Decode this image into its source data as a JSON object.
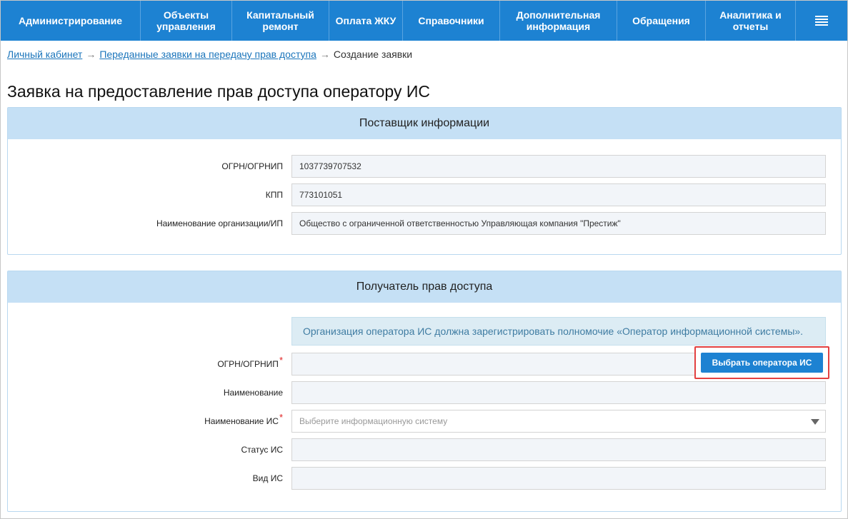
{
  "nav": {
    "items": [
      {
        "line1": "Администрирование",
        "line2": ""
      },
      {
        "line1": "Объекты",
        "line2": "управления"
      },
      {
        "line1": "Капитальный",
        "line2": "ремонт"
      },
      {
        "line1": "Оплата ЖКУ",
        "line2": ""
      },
      {
        "line1": "Справочники",
        "line2": ""
      },
      {
        "line1": "Дополнительная",
        "line2": "информация"
      },
      {
        "line1": "Обращения",
        "line2": ""
      },
      {
        "line1": "Аналитика и",
        "line2": "отчеты"
      }
    ],
    "menu_icon": "hamburger-menu-icon"
  },
  "breadcrumb": {
    "home": "Личный кабинет",
    "parent": "Переданные заявки на передачу прав доступа",
    "current": "Создание заявки",
    "separator": "→"
  },
  "page": {
    "title": "Заявка на предоставление прав доступа оператору ИС"
  },
  "provider": {
    "header": "Поставщик информации",
    "ogrn_label": "ОГРН/ОГРНИП",
    "ogrn_value": "1037739707532",
    "kpp_label": "КПП",
    "kpp_value": "773101051",
    "org_label": "Наименование организации/ИП",
    "org_value": "Общество с ограниченной ответственностью Управляющая компания \"Престиж\""
  },
  "recipient": {
    "header": "Получатель прав доступа",
    "info": "Организация оператора ИС должна зарегистрировать полномочие «Оператор информационной системы».",
    "ogrn_label": "ОГРН/ОГРНИП",
    "ogrn_value": "",
    "choose_button": "Выбрать оператора ИС",
    "name_label": "Наименование",
    "name_value": "",
    "is_name_label": "Наименование ИС",
    "is_name_placeholder": "Выберите информационную систему",
    "status_label": "Статус ИС",
    "status_value": "",
    "kind_label": "Вид ИС",
    "kind_value": "",
    "required_mark": "*"
  },
  "colors": {
    "nav_bg": "#1d82d2",
    "panel_header_bg": "#c5e0f5",
    "info_bg": "#dcecf4",
    "highlight_border": "#e34040"
  }
}
